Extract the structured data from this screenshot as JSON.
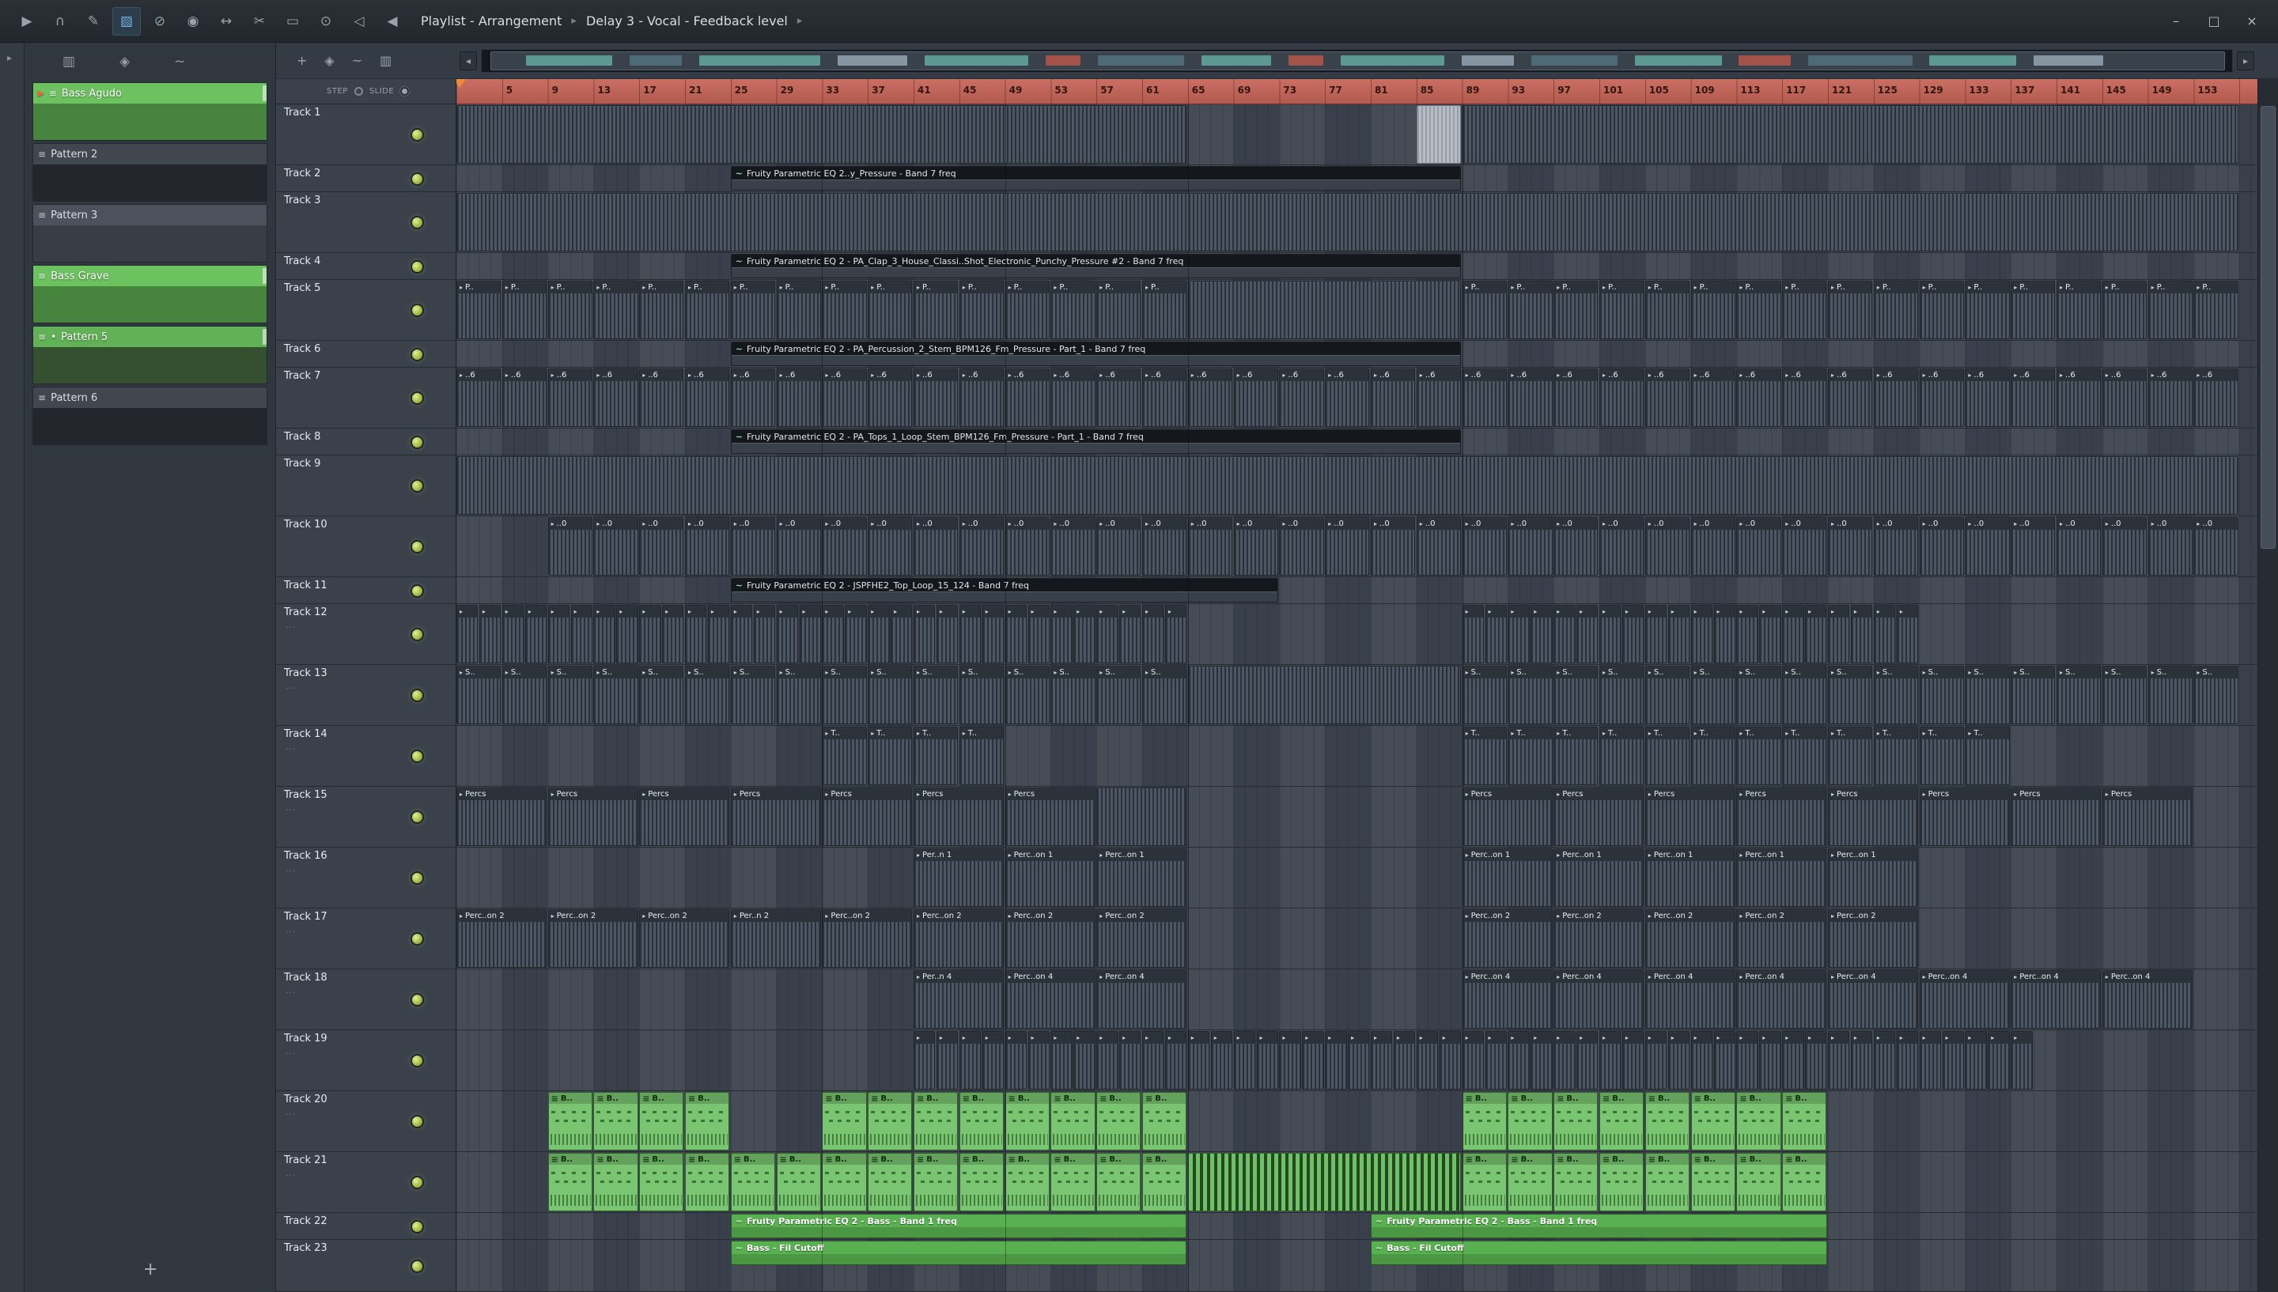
{
  "titlebar": {
    "title_parts": [
      "Playlist - Arrangement",
      "Delay 3 - Vocal  - Feedback level"
    ],
    "separator": "▸",
    "tools": [
      {
        "name": "play-icon",
        "glyph": "▶"
      },
      {
        "name": "headphones-icon",
        "glyph": "∩"
      },
      {
        "name": "draw-tool-icon",
        "glyph": "✎"
      },
      {
        "name": "paint-tool-icon",
        "glyph": "▨",
        "active": true
      },
      {
        "name": "delete-tool-icon",
        "glyph": "⊘"
      },
      {
        "name": "mute-tool-icon",
        "glyph": "◉"
      },
      {
        "name": "slip-tool-icon",
        "glyph": "↔"
      },
      {
        "name": "slice-tool-icon",
        "glyph": "✂"
      },
      {
        "name": "select-tool-icon",
        "glyph": "▭"
      },
      {
        "name": "zoom-tool-icon",
        "glyph": "⊙"
      },
      {
        "name": "playback-tool-icon",
        "glyph": "◁"
      },
      {
        "name": "preview-speaker-icon",
        "glyph": "◀"
      }
    ],
    "window_buttons": [
      {
        "name": "minimize-button",
        "glyph": "–"
      },
      {
        "name": "maximize-button",
        "glyph": "□"
      },
      {
        "name": "close-button",
        "glyph": "×"
      }
    ]
  },
  "glyphs": {
    "clip_arrow": "▸",
    "pattern_icon": "≡",
    "link_icon": "~",
    "bullet": "•",
    "play_marker": "▶",
    "dots": "...",
    "panel_arrow": "▸",
    "nav_left": "◂",
    "nav_right": "▸"
  },
  "pattern_panel": {
    "tools": [
      {
        "name": "picker-grid-icon",
        "glyph": "▥"
      },
      {
        "name": "snap-icon",
        "glyph": "◈"
      },
      {
        "name": "link-icon",
        "glyph": "~"
      }
    ],
    "patterns": [
      {
        "name": "Bass Agudo",
        "kind": "green",
        "playing": true,
        "preview": "notes"
      },
      {
        "name": "Pattern 2",
        "kind": "gray",
        "preview": "dashes"
      },
      {
        "name": "Pattern 3",
        "kind": "gray-lite",
        "preview": "sparse"
      },
      {
        "name": "Bass Grave",
        "kind": "green",
        "preview": "notes"
      },
      {
        "name": "Pattern 5",
        "kind": "green-dark",
        "bullet": true,
        "preview": "empty"
      },
      {
        "name": "Pattern 6",
        "kind": "gray",
        "preview": "dashes"
      }
    ],
    "add_label": "+"
  },
  "playlist": {
    "tools": [
      {
        "name": "add-clip-button",
        "glyph": "+"
      },
      {
        "name": "snap-icon",
        "glyph": "◈"
      },
      {
        "name": "slide-icon",
        "glyph": "~"
      },
      {
        "name": "picker-grid-icon",
        "glyph": "▥"
      }
    ],
    "step_label": "STEP",
    "slide_label": "SLIDE",
    "ruler_numbers": [
      5,
      9,
      13,
      17,
      21,
      25,
      29,
      33,
      37,
      41,
      45,
      49,
      53,
      57,
      61,
      65,
      69,
      73,
      77,
      81,
      85,
      89,
      93,
      97,
      101,
      105,
      109,
      113,
      117,
      121,
      125,
      129,
      133,
      137,
      141,
      145,
      149,
      153
    ],
    "tracks": [
      {
        "name": "Track 1",
        "size": "tall"
      },
      {
        "name": "Track 2",
        "size": "slim"
      },
      {
        "name": "Track 3",
        "size": "tall"
      },
      {
        "name": "Track 4",
        "size": "slim"
      },
      {
        "name": "Track 5",
        "size": "tall"
      },
      {
        "name": "Track 6",
        "size": "slim"
      },
      {
        "name": "Track 7",
        "size": "tall"
      },
      {
        "name": "Track 8",
        "size": "slim"
      },
      {
        "name": "Track 9",
        "size": "tall"
      },
      {
        "name": "Track 10",
        "size": "tall"
      },
      {
        "name": "Track 11",
        "size": "slim"
      },
      {
        "name": "Track 12",
        "size": "tall",
        "dots": true
      },
      {
        "name": "Track 13",
        "size": "tall",
        "dots": true
      },
      {
        "name": "Track 14",
        "size": "tall",
        "dots": true
      },
      {
        "name": "Track 15",
        "size": "tall",
        "dots": true
      },
      {
        "name": "Track 16",
        "size": "tall",
        "dots": true
      },
      {
        "name": "Track 17",
        "size": "tall",
        "dots": true
      },
      {
        "name": "Track 18",
        "size": "tall",
        "dots": true
      },
      {
        "name": "Track 19",
        "size": "tall",
        "dots": true
      },
      {
        "name": "Track 20",
        "size": "tall",
        "dots": true
      },
      {
        "name": "Track 21",
        "size": "tall",
        "dots": true
      },
      {
        "name": "Track 22",
        "size": "slim"
      },
      {
        "name": "Track 23",
        "size": "slim2"
      }
    ],
    "clips": [
      {
        "t": 1,
        "from": 1,
        "bars": 64,
        "count": 1,
        "type": "audio-plain",
        "label": ""
      },
      {
        "t": 1,
        "from": 85,
        "bars": 4,
        "count": 1,
        "type": "audio-sel",
        "label": ""
      },
      {
        "t": 1,
        "from": 89,
        "bars": 68,
        "count": 1,
        "type": "audio-plain",
        "label": ""
      },
      {
        "t": 2,
        "from": 25,
        "bars": 64,
        "count": 1,
        "type": "automation",
        "label": "Fruity Parametric EQ 2..y_Pressure - Band 7 freq"
      },
      {
        "t": 3,
        "from": 1,
        "bars": 156,
        "count": 1,
        "type": "audio-plain",
        "label": ""
      },
      {
        "t": 4,
        "from": 25,
        "bars": 64,
        "count": 1,
        "type": "automation",
        "label": "Fruity Parametric EQ 2 - PA_Clap_3_House_Classi..Shot_Electronic_Punchy_Pressure #2 - Band 7 freq"
      },
      {
        "t": 5,
        "from": 1,
        "bars": 4,
        "count": 8,
        "type": "audio",
        "label": "P.."
      },
      {
        "t": 5,
        "from": 33,
        "bars": 4,
        "count": 4,
        "type": "audio",
        "label": "P.."
      },
      {
        "t": 5,
        "from": 49,
        "bars": 4,
        "count": 4,
        "type": "audio",
        "label": "P.."
      },
      {
        "t": 5,
        "from": 65,
        "bars": 24,
        "count": 1,
        "type": "audio-plain",
        "label": ""
      },
      {
        "t": 5,
        "from": 89,
        "bars": 4,
        "count": 17,
        "type": "audio",
        "label": "P.."
      },
      {
        "t": 6,
        "from": 25,
        "bars": 64,
        "count": 1,
        "type": "automation",
        "label": "Fruity Parametric EQ 2 - PA_Percussion_2_Stem_BPM126_Fm_Pressure - Part_1 - Band 7 freq"
      },
      {
        "t": 7,
        "from": 1,
        "bars": 4,
        "count": 8,
        "type": "audio",
        "label": "..6"
      },
      {
        "t": 7,
        "from": 33,
        "bars": 4,
        "count": 4,
        "type": "audio",
        "label": "..6"
      },
      {
        "t": 7,
        "from": 49,
        "bars": 4,
        "count": 4,
        "type": "audio",
        "label": "..6"
      },
      {
        "t": 7,
        "from": 65,
        "bars": 4,
        "count": 6,
        "type": "audio",
        "label": "..6"
      },
      {
        "t": 7,
        "from": 89,
        "bars": 4,
        "count": 17,
        "type": "audio",
        "label": "..6"
      },
      {
        "t": 8,
        "from": 25,
        "bars": 64,
        "count": 1,
        "type": "automation",
        "label": "Fruity Parametric EQ 2 - PA_Tops_1_Loop_Stem_BPM126_Fm_Pressure - Part_1 - Band 7 freq"
      },
      {
        "t": 9,
        "from": 1,
        "bars": 156,
        "count": 1,
        "type": "audio-plain",
        "label": ""
      },
      {
        "t": 10,
        "from": 9,
        "bars": 4,
        "count": 6,
        "type": "audio",
        "label": "..0"
      },
      {
        "t": 10,
        "from": 33,
        "bars": 4,
        "count": 4,
        "type": "audio",
        "label": "..0"
      },
      {
        "t": 10,
        "from": 49,
        "bars": 4,
        "count": 4,
        "type": "audio",
        "label": "..0"
      },
      {
        "t": 10,
        "from": 65,
        "bars": 4,
        "count": 6,
        "type": "audio",
        "label": "..0"
      },
      {
        "t": 10,
        "from": 89,
        "bars": 4,
        "count": 17,
        "type": "audio",
        "label": "..0"
      },
      {
        "t": 11,
        "from": 25,
        "bars": 48,
        "count": 1,
        "type": "automation",
        "label": "Fruity Parametric EQ 2 - JSPFHE2_Top_Loop_15_124 - Band 7 freq"
      },
      {
        "t": 12,
        "from": 1,
        "bars": 2,
        "count": 16,
        "type": "audio",
        "label": ""
      },
      {
        "t": 12,
        "from": 33,
        "bars": 2,
        "count": 8,
        "type": "audio",
        "label": ""
      },
      {
        "t": 12,
        "from": 49,
        "bars": 2,
        "count": 8,
        "type": "audio",
        "label": ""
      },
      {
        "t": 12,
        "from": 89,
        "bars": 2,
        "count": 20,
        "type": "audio",
        "label": ""
      },
      {
        "t": 13,
        "from": 1,
        "bars": 4,
        "count": 8,
        "type": "audio",
        "label": "S.."
      },
      {
        "t": 13,
        "from": 33,
        "bars": 4,
        "count": 4,
        "type": "audio",
        "label": "S.."
      },
      {
        "t": 13,
        "from": 49,
        "bars": 4,
        "count": 4,
        "type": "audio",
        "label": "S.."
      },
      {
        "t": 13,
        "from": 65,
        "bars": 24,
        "count": 1,
        "type": "audio-plain",
        "label": ""
      },
      {
        "t": 13,
        "from": 89,
        "bars": 4,
        "count": 17,
        "type": "audio",
        "label": "S.."
      },
      {
        "t": 14,
        "from": 33,
        "bars": 4,
        "count": 4,
        "type": "audio",
        "label": "T.."
      },
      {
        "t": 14,
        "from": 89,
        "bars": 4,
        "count": 12,
        "type": "audio",
        "label": "T.."
      },
      {
        "t": 15,
        "from": 1,
        "bars": 8,
        "count": 4,
        "type": "audio",
        "label": "Percs"
      },
      {
        "t": 15,
        "from": 33,
        "bars": 8,
        "count": 2,
        "type": "audio",
        "label": "Percs"
      },
      {
        "t": 15,
        "from": 49,
        "bars": 8,
        "count": 1,
        "type": "audio",
        "label": "Percs"
      },
      {
        "t": 15,
        "from": 57,
        "bars": 8,
        "count": 1,
        "type": "audio-plain",
        "label": ""
      },
      {
        "t": 15,
        "from": 89,
        "bars": 8,
        "count": 8,
        "type": "audio",
        "label": "Percs"
      },
      {
        "t": 16,
        "from": 41,
        "bars": 8,
        "count": 1,
        "type": "audio",
        "label": "Per..n 1"
      },
      {
        "t": 16,
        "from": 49,
        "bars": 8,
        "count": 2,
        "type": "audio",
        "label": "Perc..on 1"
      },
      {
        "t": 16,
        "from": 89,
        "bars": 8,
        "count": 5,
        "type": "audio",
        "label": "Perc..on 1"
      },
      {
        "t": 17,
        "from": 1,
        "bars": 8,
        "count": 3,
        "type": "audio",
        "label": "Perc..on 2"
      },
      {
        "t": 17,
        "from": 25,
        "bars": 8,
        "count": 1,
        "type": "audio",
        "label": "Per..n 2"
      },
      {
        "t": 17,
        "from": 33,
        "bars": 8,
        "count": 2,
        "type": "audio",
        "label": "Perc..on 2"
      },
      {
        "t": 17,
        "from": 49,
        "bars": 8,
        "count": 2,
        "type": "audio",
        "label": "Perc..on 2"
      },
      {
        "t": 17,
        "from": 89,
        "bars": 8,
        "count": 5,
        "type": "audio",
        "label": "Perc..on 2"
      },
      {
        "t": 18,
        "from": 41,
        "bars": 8,
        "count": 1,
        "type": "audio",
        "label": "Per..n 4"
      },
      {
        "t": 18,
        "from": 49,
        "bars": 8,
        "count": 2,
        "type": "audio",
        "label": "Perc..on 4"
      },
      {
        "t": 18,
        "from": 89,
        "bars": 8,
        "count": 8,
        "type": "audio",
        "label": "Perc..on 4"
      },
      {
        "t": 19,
        "from": 41,
        "bars": 2,
        "count": 24,
        "type": "audio",
        "label": ""
      },
      {
        "t": 19,
        "from": 89,
        "bars": 2,
        "count": 25,
        "type": "audio",
        "label": ""
      },
      {
        "t": 20,
        "from": 9,
        "bars": 4,
        "count": 4,
        "type": "pattern",
        "label": "B.."
      },
      {
        "t": 20,
        "from": 33,
        "bars": 4,
        "count": 8,
        "type": "pattern",
        "label": "B.."
      },
      {
        "t": 20,
        "from": 89,
        "bars": 4,
        "count": 8,
        "type": "pattern",
        "label": "B.."
      },
      {
        "t": 21,
        "from": 9,
        "bars": 4,
        "count": 6,
        "type": "pattern",
        "label": "B.."
      },
      {
        "t": 21,
        "from": 33,
        "bars": 4,
        "count": 8,
        "type": "pattern",
        "label": "B.."
      },
      {
        "t": 21,
        "from": 65,
        "bars": 24,
        "count": 1,
        "type": "pattern-striped",
        "label": ""
      },
      {
        "t": 21,
        "from": 89,
        "bars": 4,
        "count": 8,
        "type": "pattern",
        "label": "B.."
      },
      {
        "t": 22,
        "from": 25,
        "bars": 40,
        "count": 1,
        "type": "automation-green",
        "label": "Fruity Parametric EQ 2 - Bass - Band 1 freq"
      },
      {
        "t": 22,
        "from": 81,
        "bars": 40,
        "count": 1,
        "type": "automation-green",
        "label": "Fruity Parametric EQ 2 - Bass - Band 1 freq"
      },
      {
        "t": 23,
        "from": 25,
        "bars": 40,
        "count": 1,
        "type": "automation-green",
        "label": "Bass - Fil Cutoff"
      },
      {
        "t": 23,
        "from": 81,
        "bars": 40,
        "count": 1,
        "type": "automation-green",
        "label": "Bass - Fil Cutoff"
      }
    ],
    "section_lines": [
      33,
      49,
      65,
      89
    ],
    "overview_segments": [
      {
        "x": 2,
        "w": 5,
        "c": "#5e9e96"
      },
      {
        "x": 8,
        "w": 3,
        "c": "#4f6d79"
      },
      {
        "x": 12,
        "w": 7,
        "c": "#5e9e96"
      },
      {
        "x": 20,
        "w": 4,
        "c": "#8b9aa8"
      },
      {
        "x": 25,
        "w": 6,
        "c": "#5e9e96"
      },
      {
        "x": 32,
        "w": 2,
        "c": "#a9544a"
      },
      {
        "x": 35,
        "w": 5,
        "c": "#4f6d79"
      },
      {
        "x": 41,
        "w": 4,
        "c": "#5e9e96"
      },
      {
        "x": 46,
        "w": 2,
        "c": "#a9544a"
      },
      {
        "x": 49,
        "w": 6,
        "c": "#5e9e96"
      },
      {
        "x": 56,
        "w": 3,
        "c": "#8b9aa8"
      },
      {
        "x": 60,
        "w": 5,
        "c": "#4f6d79"
      },
      {
        "x": 66,
        "w": 5,
        "c": "#5e9e96"
      },
      {
        "x": 72,
        "w": 3,
        "c": "#a9544a"
      },
      {
        "x": 76,
        "w": 6,
        "c": "#4f6d79"
      },
      {
        "x": 83,
        "w": 5,
        "c": "#5e9e96"
      },
      {
        "x": 89,
        "w": 4,
        "c": "#8b9aa8"
      }
    ]
  },
  "colors": {
    "accent_green": "#6cc25f",
    "ruler_salmon": "#c4685d",
    "clip_slate": "#4d5663",
    "led_green": "#a7bd45",
    "tool_active_blue": "#6fb7e8"
  }
}
